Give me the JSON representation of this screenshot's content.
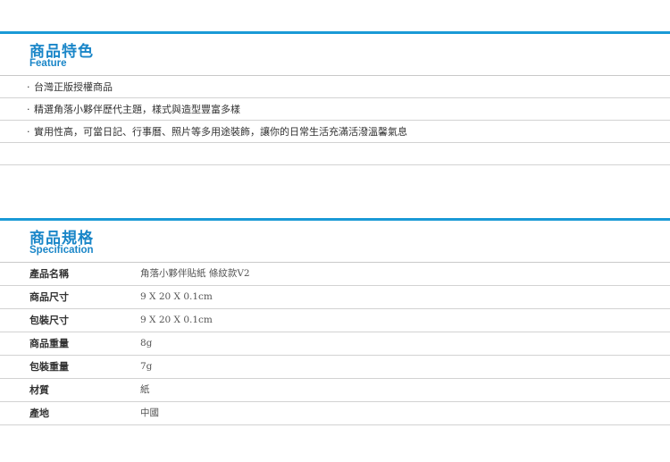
{
  "feature": {
    "title_zh": "商品特色",
    "title_en": "Feature",
    "items": [
      "台灣正版授權商品",
      "精選角落小夥伴歷代主題，樣式與造型豐富多樣",
      "實用性高，可當日記、行事曆、照片等多用途裝飾，讓你的日常生活充滿活潑溫馨氣息"
    ],
    "bullet": "·"
  },
  "spec": {
    "title_zh": "商品規格",
    "title_en": "Specification",
    "rows": [
      {
        "label": "產品名稱",
        "value": "角落小夥伴貼紙 條紋款V2"
      },
      {
        "label": "商品尺寸",
        "value": "9 X 20 X 0.1cm"
      },
      {
        "label": "包裝尺寸",
        "value": "9 X 20 X 0.1cm"
      },
      {
        "label": "商品重量",
        "value": "8g"
      },
      {
        "label": "包裝重量",
        "value": "7g"
      },
      {
        "label": "材質",
        "value": "紙"
      },
      {
        "label": "產地",
        "value": "中國"
      }
    ]
  },
  "colors": {
    "accent": "#1a9ad6",
    "title": "#1a86c8",
    "divider": "#d2d2d2"
  }
}
